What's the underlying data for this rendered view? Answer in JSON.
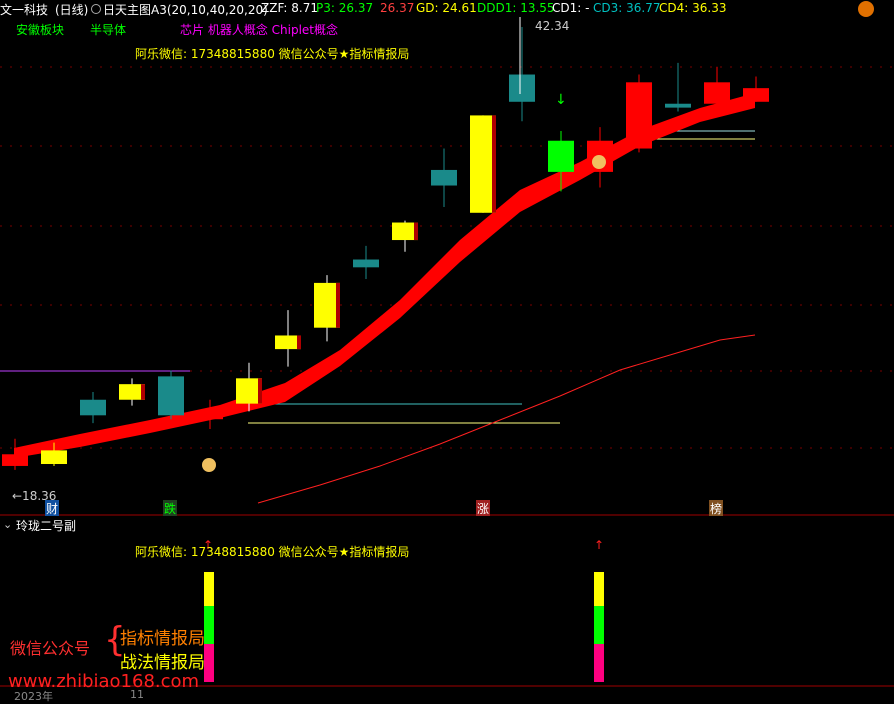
{
  "header": {
    "stock_name": "文一科技",
    "period": "(日线)",
    "indicator": "日天主图A3(20,10,40,20,20)",
    "zzf": "ZZF: 8.71",
    "p3": "P3: 26.37",
    "p_red": "26.37",
    "gd": "GD: 24.61",
    "ddd1": "DDD1: 13.55",
    "cd1": "CD1: -",
    "cd3": "CD3: 36.77",
    "cd4": "CD4: 36.33"
  },
  "concepts": {
    "block1": "安徽板块",
    "block2": "半导体",
    "block3": "芯片 机器人概念 Chiplet概念"
  },
  "watermark_top": "阿乐微信: 17348815880  微信公众号★指标情报局",
  "price_labels": {
    "high": "42.34",
    "low": "←18.36"
  },
  "markers": {
    "cai": "财",
    "die": "跌",
    "zhang": "涨",
    "bang": "榜"
  },
  "sub_panel": {
    "title": "玲珑二号副",
    "watermark": "阿乐微信: 17348815880  微信公众号★指标情报局"
  },
  "brand": {
    "left": "微信公众号",
    "line1": "指标情报局",
    "line2": "战法情报局",
    "url": "www.zhibiao168.com"
  },
  "axis": {
    "year": "2023年",
    "month": "11"
  },
  "colors": {
    "bg": "#000000",
    "up": "#ffff00",
    "down": "#008080",
    "red": "#ff0000",
    "green": "#00ff00",
    "magenta": "#ff0080"
  },
  "chart_data": {
    "type": "candlestick",
    "y_range": [
      18.36,
      42.34
    ],
    "candles": [
      {
        "o": 20.4,
        "h": 21.2,
        "l": 19.6,
        "c": 19.8,
        "col": "red"
      },
      {
        "o": 20.6,
        "h": 21.0,
        "l": 19.8,
        "c": 19.9,
        "col": "yellow_down"
      },
      {
        "o": 23.2,
        "h": 23.6,
        "l": 22.0,
        "c": 22.4,
        "col": "teal"
      },
      {
        "o": 24.0,
        "h": 24.3,
        "l": 22.9,
        "c": 23.2,
        "col": "yellow"
      },
      {
        "o": 24.4,
        "h": 24.7,
        "l": 22.2,
        "c": 22.4,
        "col": "teal"
      },
      {
        "o": 22.6,
        "h": 23.2,
        "l": 21.7,
        "c": 22.2,
        "col": "red"
      },
      {
        "o": 24.3,
        "h": 25.1,
        "l": 22.6,
        "c": 23.0,
        "col": "yellow"
      },
      {
        "o": 26.5,
        "h": 27.8,
        "l": 24.9,
        "c": 25.8,
        "col": "yellow"
      },
      {
        "o": 29.2,
        "h": 29.6,
        "l": 26.2,
        "c": 26.9,
        "col": "yellow"
      },
      {
        "o": 30.4,
        "h": 31.1,
        "l": 29.4,
        "c": 30.0,
        "col": "teal"
      },
      {
        "o": 32.3,
        "h": 32.4,
        "l": 30.8,
        "c": 31.4,
        "col": "yellow"
      },
      {
        "o": 35.0,
        "h": 36.1,
        "l": 33.1,
        "c": 34.2,
        "col": "teal"
      },
      {
        "o": 37.8,
        "h": 37.8,
        "l": 32.8,
        "c": 32.8,
        "col": "yellow"
      },
      {
        "o": 39.9,
        "h": 42.34,
        "l": 37.5,
        "c": 38.5,
        "col": "teal"
      },
      {
        "o": 36.5,
        "h": 37.0,
        "l": 33.9,
        "c": 34.9,
        "col": "green"
      },
      {
        "o": 36.5,
        "h": 37.2,
        "l": 34.1,
        "c": 34.9,
        "col": "red"
      },
      {
        "o": 39.5,
        "h": 39.9,
        "l": 35.9,
        "c": 36.1,
        "col": "red"
      },
      {
        "o": 38.4,
        "h": 40.5,
        "l": 38.0,
        "c": 38.2,
        "col": "teal"
      },
      {
        "o": 39.5,
        "h": 40.3,
        "l": 38.0,
        "c": 38.4,
        "col": "red"
      },
      {
        "o": 39.2,
        "h": 39.8,
        "l": 38.5,
        "c": 38.5,
        "col": "red"
      }
    ]
  }
}
